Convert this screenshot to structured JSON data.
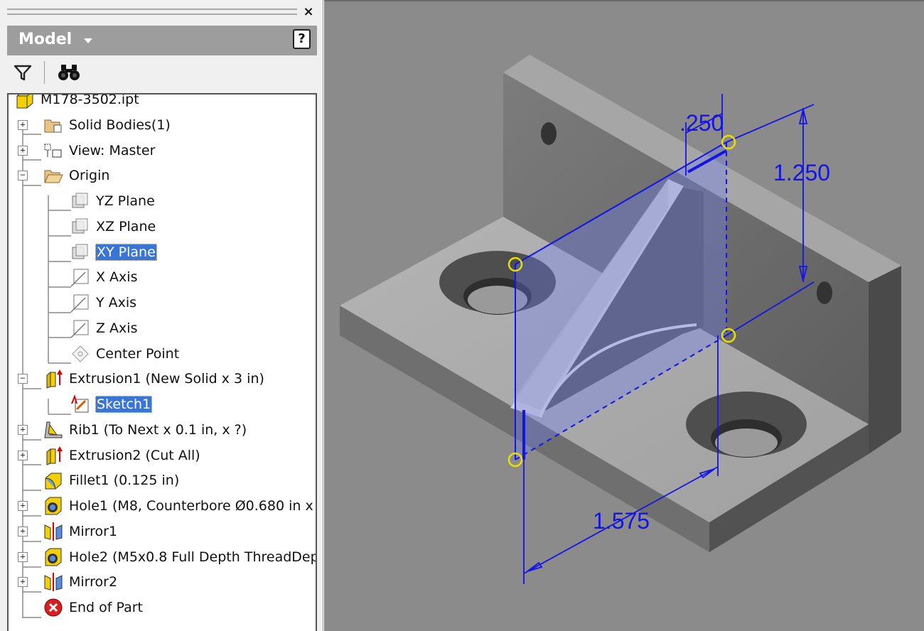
{
  "browser": {
    "title": "Model",
    "close_glyph": "×",
    "help_glyph": "?",
    "toolbar": {
      "filter_icon": "funnel-icon",
      "find_icon": "binoculars-icon"
    },
    "tree": [
      {
        "id": "part",
        "label": "M178-3502.ipt",
        "icon": "part-icon"
      },
      {
        "id": "solid-bodies",
        "label": "Solid Bodies(1)",
        "icon": "solid-bodies-folder-icon",
        "expander": "+"
      },
      {
        "id": "view-master",
        "label": "View: Master",
        "icon": "view-rep-icon",
        "expander": "+"
      },
      {
        "id": "origin",
        "label": "Origin",
        "icon": "open-folder-icon",
        "expander": "−"
      },
      {
        "id": "yz-plane",
        "label": "YZ Plane",
        "icon": "plane-icon"
      },
      {
        "id": "xz-plane",
        "label": "XZ Plane",
        "icon": "plane-icon"
      },
      {
        "id": "xy-plane",
        "label": "XY Plane",
        "icon": "plane-icon",
        "selected": true
      },
      {
        "id": "x-axis",
        "label": "X Axis",
        "icon": "axis-icon"
      },
      {
        "id": "y-axis",
        "label": "Y Axis",
        "icon": "axis-icon"
      },
      {
        "id": "z-axis",
        "label": "Z Axis",
        "icon": "axis-icon"
      },
      {
        "id": "center-point",
        "label": "Center Point",
        "icon": "center-point-icon"
      },
      {
        "id": "extrusion1",
        "label": "Extrusion1 (New Solid x 3 in)",
        "icon": "extrude-icon",
        "expander": "−"
      },
      {
        "id": "sketch1",
        "label": "Sketch1",
        "icon": "sketch-icon",
        "selected": true
      },
      {
        "id": "rib1",
        "label": "Rib1 (To Next x 0.1 in, x ?)",
        "icon": "rib-icon",
        "expander": "+"
      },
      {
        "id": "extrusion2",
        "label": "Extrusion2 (Cut All)",
        "icon": "extrude-icon",
        "expander": "+"
      },
      {
        "id": "fillet1",
        "label": "Fillet1 (0.125 in)",
        "icon": "fillet-icon"
      },
      {
        "id": "hole1",
        "label": "Hole1 (M8, Counterbore Ø0.680 in x",
        "icon": "hole-icon",
        "expander": "+"
      },
      {
        "id": "mirror1",
        "label": "Mirror1",
        "icon": "mirror-icon",
        "expander": "+"
      },
      {
        "id": "hole2",
        "label": "Hole2 (M5x0.8 Full Depth ThreadDep",
        "icon": "hole-icon",
        "expander": "+"
      },
      {
        "id": "mirror2",
        "label": "Mirror2",
        "icon": "mirror-icon",
        "expander": "+"
      },
      {
        "id": "end-of-part",
        "label": "End of Part",
        "icon": "end-of-part-icon"
      }
    ]
  },
  "viewport": {
    "dimensions": {
      "rib_thickness": ".250",
      "height": "1.250",
      "length": "1.575"
    },
    "colors": {
      "background": "#8b8b8b",
      "dimension": "#1414e6",
      "constraint_point": "#e8e000",
      "selection": "#3875d7"
    }
  }
}
